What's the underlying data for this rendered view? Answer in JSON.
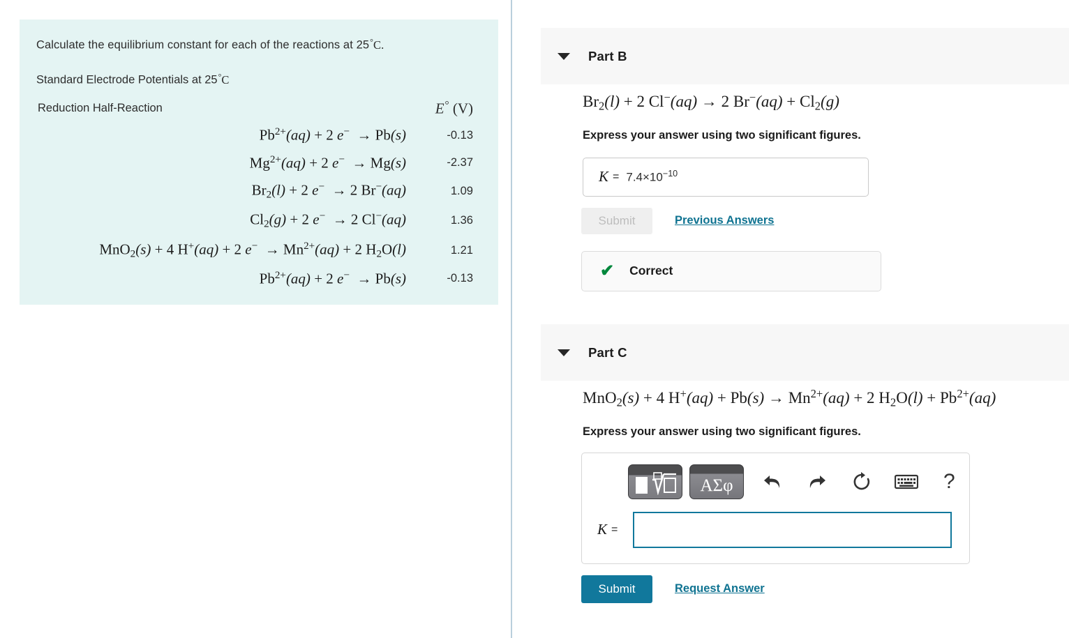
{
  "left": {
    "prompt": "Calculate the equilibrium constant for each of the reactions at 25",
    "prompt_deg": "°",
    "prompt_unit": "C.",
    "table_title": "Standard Electrode Potentials at 25",
    "table_title_deg": "°",
    "table_title_unit": "C",
    "col_reaction": "Reduction Half-Reaction",
    "col_potential_symbol": "E",
    "col_potential_unit": "(V)",
    "rows": [
      {
        "species": "Pb",
        "charge": "2+",
        "state1": "(aq)",
        "electrons": "+ 2 e",
        "echarge": "−",
        "arrow": "→",
        "product": "Pb",
        "pstate": "(s)",
        "value": "-0.13"
      },
      {
        "species": "Mg",
        "charge": "2+",
        "state1": "(aq)",
        "electrons": "+ 2 e",
        "echarge": "−",
        "arrow": "→",
        "product": "Mg",
        "pstate": "(s)",
        "value": "-2.37"
      },
      {
        "species": "Br",
        "charge": "",
        "state1": "(l)",
        "electrons": "+ 2 e",
        "echarge": "−",
        "arrow": "→",
        "product": "2 Br",
        "pstate": "(aq)",
        "value": "1.09"
      },
      {
        "species": "Cl",
        "charge": "",
        "state1": "(g)",
        "electrons": "+ 2 e",
        "echarge": "−",
        "arrow": "→",
        "product": "2 Cl",
        "pstate": "(aq)",
        "value": "1.36"
      },
      {
        "species": "MnO",
        "charge": "",
        "state1": "(s)",
        "electrons": "+ 4 H+(aq) + 2 e",
        "echarge": "−",
        "arrow": "→",
        "product": "Mn2+(aq) + 2 H2O",
        "pstate": "(l)",
        "value": "1.21"
      },
      {
        "species": "Pb",
        "charge": "2+",
        "state1": "(aq)",
        "electrons": "+ 2 e",
        "echarge": "−",
        "arrow": "→",
        "product": "Pb",
        "pstate": "(s)",
        "value": "-0.13"
      }
    ],
    "row_values": [
      "-0.13",
      "-2.37",
      "1.09",
      "1.36",
      "1.21",
      "-0.13"
    ]
  },
  "part_b": {
    "title": "Part B",
    "caret": "caret-down-icon",
    "equation_plain": "Br2(l) + 2 Cl−(aq) → 2 Br−(aq) + Cl2(g)",
    "instruction": "Express your answer using two significant figures.",
    "k_label": "K",
    "equals": "=",
    "answer_mantissa": "7.4×10",
    "answer_exponent": "−10",
    "submit_label": "Submit",
    "previous_answers_label": "Previous Answers",
    "feedback_label": "Correct",
    "feedback_icon": "check-icon",
    "feedback_color": "#00873c"
  },
  "part_c": {
    "title": "Part C",
    "caret": "caret-down-icon",
    "equation_plain": "MnO2(s) + 4 H+(aq) + Pb(s) → Mn2+(aq) + 2 H2O(l) + Pb2+(aq)",
    "instruction": "Express your answer using two significant figures.",
    "k_label": "K",
    "equals": "=",
    "input_value": "",
    "input_placeholder": "",
    "toolbar": {
      "template_button": "math-template",
      "greek_button": "ΑΣφ",
      "undo": "undo-icon",
      "redo": "redo-icon",
      "reset": "reset-icon",
      "keyboard": "keyboard-icon",
      "help": "?"
    },
    "submit_label": "Submit",
    "request_answer_label": "Request Answer"
  },
  "theme": {
    "card_bg": "#e4f4f3",
    "header_bg": "#f7f7f7",
    "accent": "#11789c",
    "link": "#0f7391",
    "success": "#00873c"
  }
}
